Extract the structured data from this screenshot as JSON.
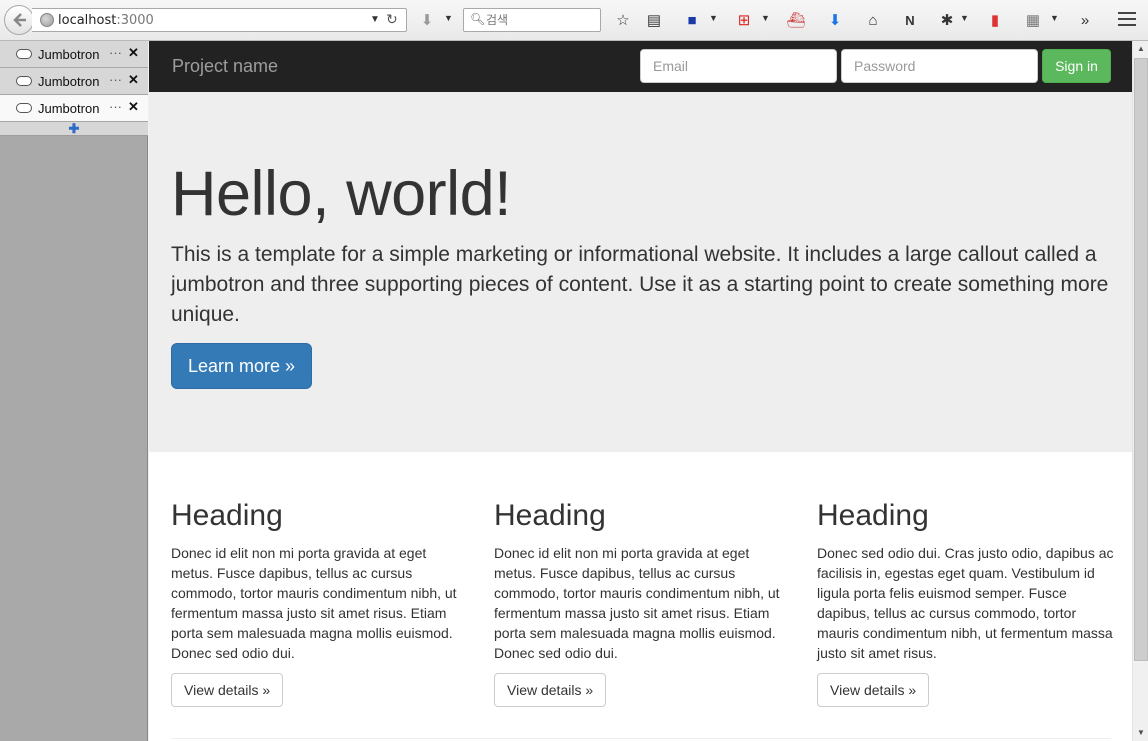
{
  "browser": {
    "url_host": "localhost",
    "url_port": ":3000",
    "search_placeholder": "검색"
  },
  "tabs": [
    {
      "label": "Jumbotron",
      "active": false
    },
    {
      "label": "Jumbotron",
      "active": false
    },
    {
      "label": "Jumbotron",
      "active": true
    }
  ],
  "tab_ellipsis": "···",
  "navbar": {
    "brand": "Project name",
    "email_placeholder": "Email",
    "password_placeholder": "Password",
    "signin_label": "Sign in"
  },
  "jumbotron": {
    "heading": "Hello, world!",
    "text": "This is a template for a simple marketing or informational website. It includes a large callout called a jumbotron and three supporting pieces of content. Use it as a starting point to create something more unique.",
    "button": "Learn more »"
  },
  "columns": [
    {
      "heading": "Heading",
      "text": "Donec id elit non mi porta gravida at eget metus. Fusce dapibus, tellus ac cursus commodo, tortor mauris condimentum nibh, ut fermentum massa justo sit amet risus. Etiam porta sem malesuada magna mollis euismod. Donec sed odio dui.",
      "button": "View details »"
    },
    {
      "heading": "Heading",
      "text": "Donec id elit non mi porta gravida at eget metus. Fusce dapibus, tellus ac cursus commodo, tortor mauris condimentum nibh, ut fermentum massa justo sit amet risus. Etiam porta sem malesuada magna mollis euismod. Donec sed odio dui.",
      "button": "View details »"
    },
    {
      "heading": "Heading",
      "text": "Donec sed odio dui. Cras justo odio, dapibus ac facilisis in, egestas eget quam. Vestibulum id ligula porta felis euismod semper. Fusce dapibus, tellus ac cursus commodo, tortor mauris condimentum nibh, ut fermentum massa justo sit amet risus.",
      "button": "View details »"
    }
  ],
  "colors": {
    "navbar_bg": "#222222",
    "signin_green": "#5cb85c",
    "primary_blue": "#337ab7",
    "jumbotron_bg": "#eeeeee"
  }
}
